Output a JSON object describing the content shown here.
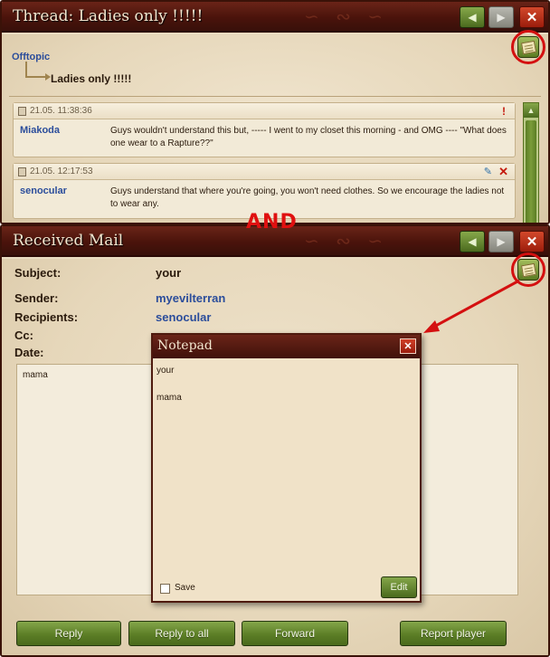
{
  "annotation": {
    "separator_label": "AND"
  },
  "thread_window": {
    "title": "Thread: Ladies only !!!!!",
    "close_glyph": "✕",
    "breadcrumb": {
      "forum": "Offtopic",
      "thread": "Ladies only !!!!!"
    },
    "posts": [
      {
        "date": "21.05. 11:38:36",
        "author": "Miakoda",
        "text": "Guys wouldn't understand this but, ----- I went to my closet this morning - and OMG ---- \"What does one wear to a Rapture??\"",
        "action_glyph": "!"
      },
      {
        "date": "21.05. 12:17:53",
        "author": "senocular",
        "text": "Guys understand that where you're going, you won't need clothes. So we encourage the ladies not to wear any.",
        "edit_glyph": "✎",
        "delete_glyph": "✕"
      }
    ]
  },
  "mail_window": {
    "title": "Received Mail",
    "close_glyph": "✕",
    "fields": {
      "subject_label": "Subject:",
      "subject_value": "your",
      "sender_label": "Sender:",
      "sender_value": "myevilterran",
      "recipients_label": "Recipients:",
      "recipients_value": "senocular",
      "cc_label": "Cc:",
      "date_label": "Date:"
    },
    "body": "mama",
    "buttons": {
      "reply": "Reply",
      "reply_all": "Reply to all",
      "forward": "Forward",
      "report": "Report player"
    }
  },
  "notepad": {
    "title": "Notepad",
    "close_glyph": "✕",
    "lines": [
      "your",
      "mama"
    ],
    "save_label": "Save",
    "save_checked": false,
    "edit_label": "Edit"
  },
  "colors": {
    "titlebar": "#4a130b",
    "parchment": "#e9dcc2",
    "link_blue": "#2b4d9b",
    "button_green": "#5c7e26",
    "annotation_red": "#d41010"
  },
  "icons": [
    "notepad-icon",
    "prev-arrow-icon",
    "next-arrow-icon",
    "close-icon",
    "flag-icon",
    "edit-icon",
    "delete-icon",
    "document-icon",
    "scroll-up-icon"
  ]
}
